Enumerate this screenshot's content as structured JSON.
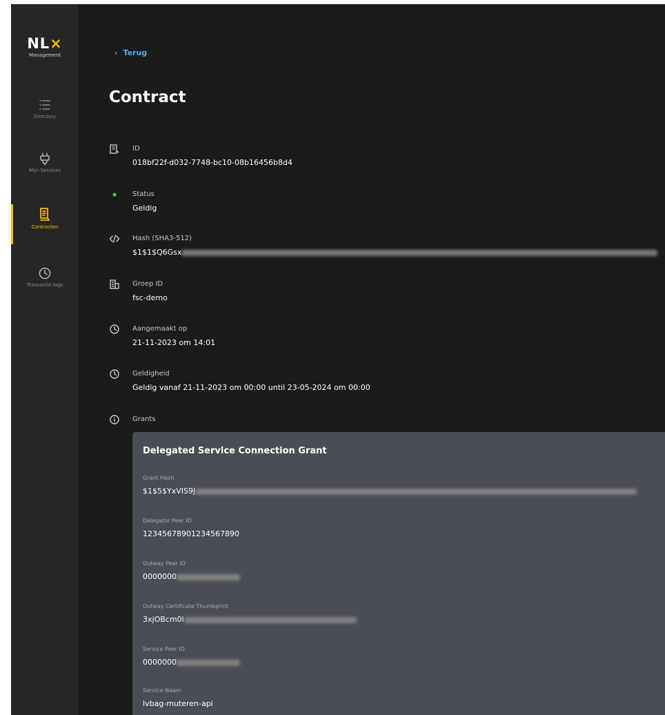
{
  "brand": {
    "logo_text": "NL",
    "logo_accent": "×",
    "logo_sub": "Management"
  },
  "sidebar": {
    "items": [
      {
        "label": "Directory",
        "icon": "list-icon"
      },
      {
        "label": "Mijn Services",
        "icon": "plug-icon"
      },
      {
        "label": "Contracten",
        "icon": "contract-icon",
        "active": true
      },
      {
        "label": "Transactie logs",
        "icon": "clock-icon"
      }
    ]
  },
  "header": {
    "back_label": "Terug",
    "back_icon": "chevron-left-icon",
    "title": "Contract"
  },
  "fields": {
    "id": {
      "label": "ID",
      "value": "018bf22f-d032-7748-bc10-08b16456b8d4"
    },
    "status": {
      "label": "Status",
      "value": "Geldig"
    },
    "hash": {
      "label": "Hash (SHA3-512)",
      "value": "$1$1$Q6Gsx"
    },
    "group": {
      "label": "Groep ID",
      "value": "fsc-demo"
    },
    "created": {
      "label": "Aangemaakt op",
      "value": "21-11-2023 om 14:01"
    },
    "validity": {
      "label": "Geldigheid",
      "value": "Geldig vanaf 21-11-2023 om 00:00 until 23-05-2024 om 00:00"
    },
    "grants": {
      "label": "Grants"
    }
  },
  "grant": {
    "title": "Delegated Service Connection Grant",
    "items": [
      {
        "label": "Grant Hash",
        "value": "$1$5$YxVIS9J"
      },
      {
        "label": "Delegator Peer ID",
        "value": "12345678901234567890"
      },
      {
        "label": "Outway Peer ID",
        "value": "0000000"
      },
      {
        "label": "Outway Certificate Thumbprint",
        "value": "3xjOBcm0l"
      },
      {
        "label": "Service Peer ID",
        "value": "0000000"
      },
      {
        "label": "Service Naam",
        "value": "lvbag-muteren-api"
      }
    ]
  },
  "colors": {
    "accent": "#feb900",
    "link": "#4ab1e8",
    "status_ok": "#3fbf62",
    "panel": "#4a4d55"
  }
}
